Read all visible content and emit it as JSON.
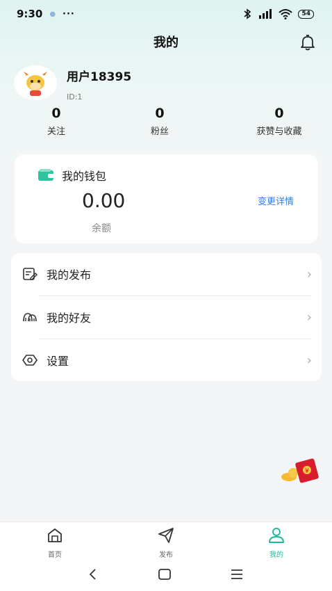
{
  "status": {
    "time": "9:30",
    "dots": "···",
    "battery": "54"
  },
  "header": {
    "title": "我的"
  },
  "profile": {
    "name": "用户18395",
    "id": "ID:1"
  },
  "stats": [
    {
      "value": "0",
      "label": "关注"
    },
    {
      "value": "0",
      "label": "粉丝"
    },
    {
      "value": "0",
      "label": "获赞与收藏"
    }
  ],
  "wallet": {
    "title": "我的钱包",
    "amount": "0.00",
    "balance_label": "余额",
    "detail_link": "变更详情"
  },
  "menu": [
    {
      "label": "我的发布",
      "icon": "edit-note-icon"
    },
    {
      "label": "我的好友",
      "icon": "friends-icon"
    },
    {
      "label": "设置",
      "icon": "settings-hexagon-icon"
    }
  ],
  "tabs": [
    {
      "label": "首页",
      "icon": "home-icon"
    },
    {
      "label": "发布",
      "icon": "send-icon"
    },
    {
      "label": "我的",
      "icon": "user-icon",
      "active": true
    }
  ],
  "colors": {
    "accent": "#1fb89a",
    "link": "#2b7de9",
    "wallet_icon": "#2ec4a0"
  }
}
